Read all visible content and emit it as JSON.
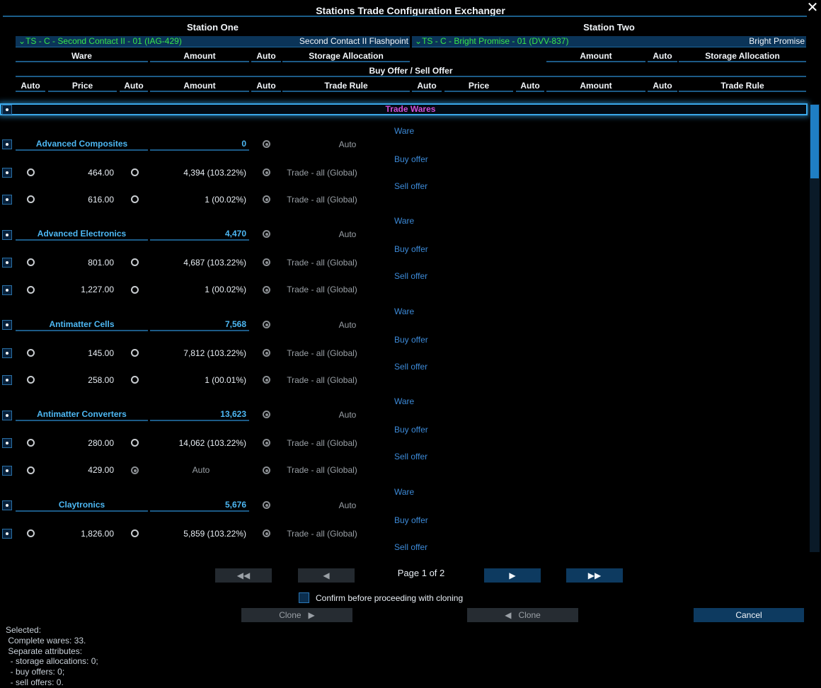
{
  "window": {
    "title": "Stations Trade Configuration Exchanger",
    "close_icon": "close-icon"
  },
  "stations": {
    "one": {
      "label": "Station One",
      "selector": "TS - C - Second Contact II - 01 (IAG-429)",
      "name": "Second Contact II Flashpoint"
    },
    "two": {
      "label": "Station Two",
      "selector": "TS - C - Bright Promise - 01 (DVV-837)",
      "name": "Bright Promise"
    }
  },
  "headers": {
    "ware": "Ware",
    "amount": "Amount",
    "auto": "Auto",
    "storage_allocation": "Storage Allocation",
    "buy_sell": "Buy Offer / Sell Offer",
    "price": "Price",
    "trade_rule": "Trade Rule"
  },
  "section": {
    "trade_wares": "Trade Wares"
  },
  "wares": [
    {
      "name": "Advanced Composites",
      "amount": "0",
      "auto_label": "Auto",
      "buy": {
        "price": "464.00",
        "amount": "4,394 (103.22%)",
        "rule": "Trade - all (Global)"
      },
      "sell": {
        "price": "616.00",
        "amount": "1 (00.02%)",
        "rule": "Trade - all (Global)"
      }
    },
    {
      "name": "Advanced Electronics",
      "amount": "4,470",
      "auto_label": "Auto",
      "buy": {
        "price": "801.00",
        "amount": "4,687 (103.22%)",
        "rule": "Trade - all (Global)"
      },
      "sell": {
        "price": "1,227.00",
        "amount": "1 (00.02%)",
        "rule": "Trade - all (Global)"
      }
    },
    {
      "name": "Antimatter Cells",
      "amount": "7,568",
      "auto_label": "Auto",
      "buy": {
        "price": "145.00",
        "amount": "7,812 (103.22%)",
        "rule": "Trade - all (Global)"
      },
      "sell": {
        "price": "258.00",
        "amount": "1 (00.01%)",
        "rule": "Trade - all (Global)"
      }
    },
    {
      "name": "Antimatter Converters",
      "amount": "13,623",
      "auto_label": "Auto",
      "buy": {
        "price": "280.00",
        "amount": "14,062 (103.22%)",
        "rule": "Trade - all (Global)"
      },
      "sell": {
        "price": "429.00",
        "amount": "Auto",
        "rule": "Trade - all (Global)"
      }
    },
    {
      "name": "Claytronics",
      "amount": "5,676",
      "auto_label": "Auto",
      "buy": {
        "price": "1,826.00",
        "amount": "5,859 (103.22%)",
        "rule": "Trade - all (Global)"
      },
      "sell": null
    }
  ],
  "mid_labels": {
    "ware": "Ware",
    "buy": "Buy offer",
    "sell": "Sell offer"
  },
  "pagination": {
    "page_label": "Page 1 of 2"
  },
  "confirm_label": "Confirm before proceeding with cloning",
  "buttons": {
    "clone_right": "Clone",
    "clone_left": "Clone",
    "cancel": "Cancel"
  },
  "status_lines": [
    "Selected:",
    " Complete wares: 33.",
    " Separate attributes:",
    "  - storage allocations: 0;",
    "  - buy offers: 0;",
    "  - sell offers: 0."
  ],
  "colors": {
    "accent": "#4db8f4",
    "station_selector": "#38e64a",
    "trade_wares": "#d24fd8",
    "button": "#0d3a60"
  }
}
